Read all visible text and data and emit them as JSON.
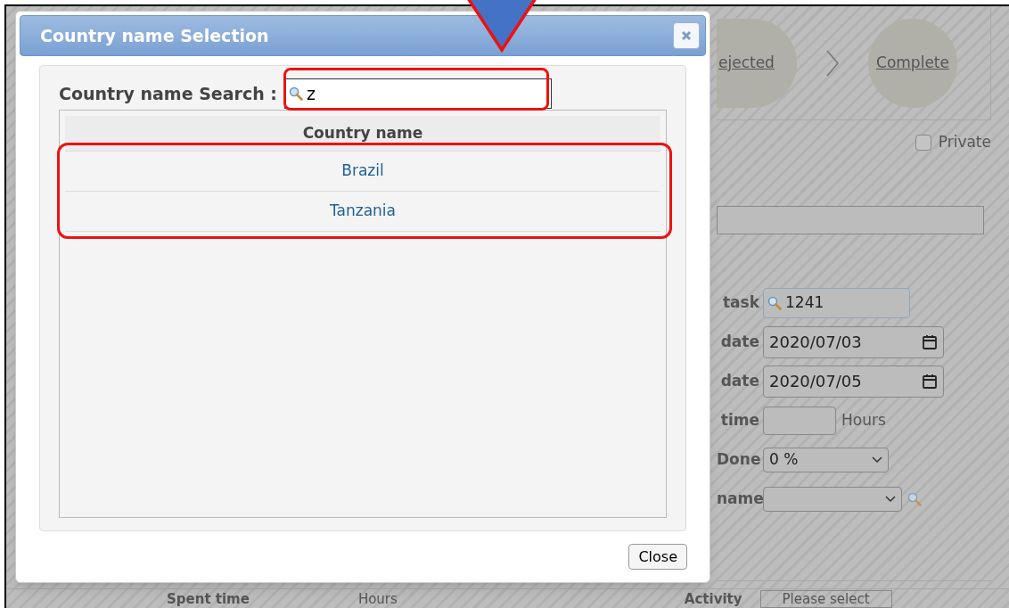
{
  "background_form": {
    "workflow_steps": [
      {
        "label": "ejected"
      },
      {
        "label": "Complete"
      }
    ],
    "private": {
      "label": "Private",
      "checked": false
    },
    "fields": [
      {
        "kind": "search",
        "label": "task",
        "value": "1241"
      },
      {
        "kind": "date",
        "label": "date",
        "value": "2020/07/03"
      },
      {
        "kind": "date",
        "label": "date",
        "value": "2020/07/05"
      },
      {
        "kind": "hours",
        "label": "time",
        "unit": "Hours"
      },
      {
        "kind": "select",
        "label": "Done",
        "value": "0 %"
      },
      {
        "kind": "select_search",
        "label": "name"
      }
    ],
    "bottom_row": {
      "spent_time_label": "Spent time",
      "unit": "Hours",
      "activity_label": "Activity",
      "activity_placeholder": "Please select"
    }
  },
  "dialog": {
    "title": "Country name Selection",
    "search_label": "Country name Search :",
    "search_value": "z",
    "column": "Country name",
    "rows": [
      {
        "name": "Brazil"
      },
      {
        "name": "Tanzania"
      }
    ],
    "close_button": "Close"
  }
}
